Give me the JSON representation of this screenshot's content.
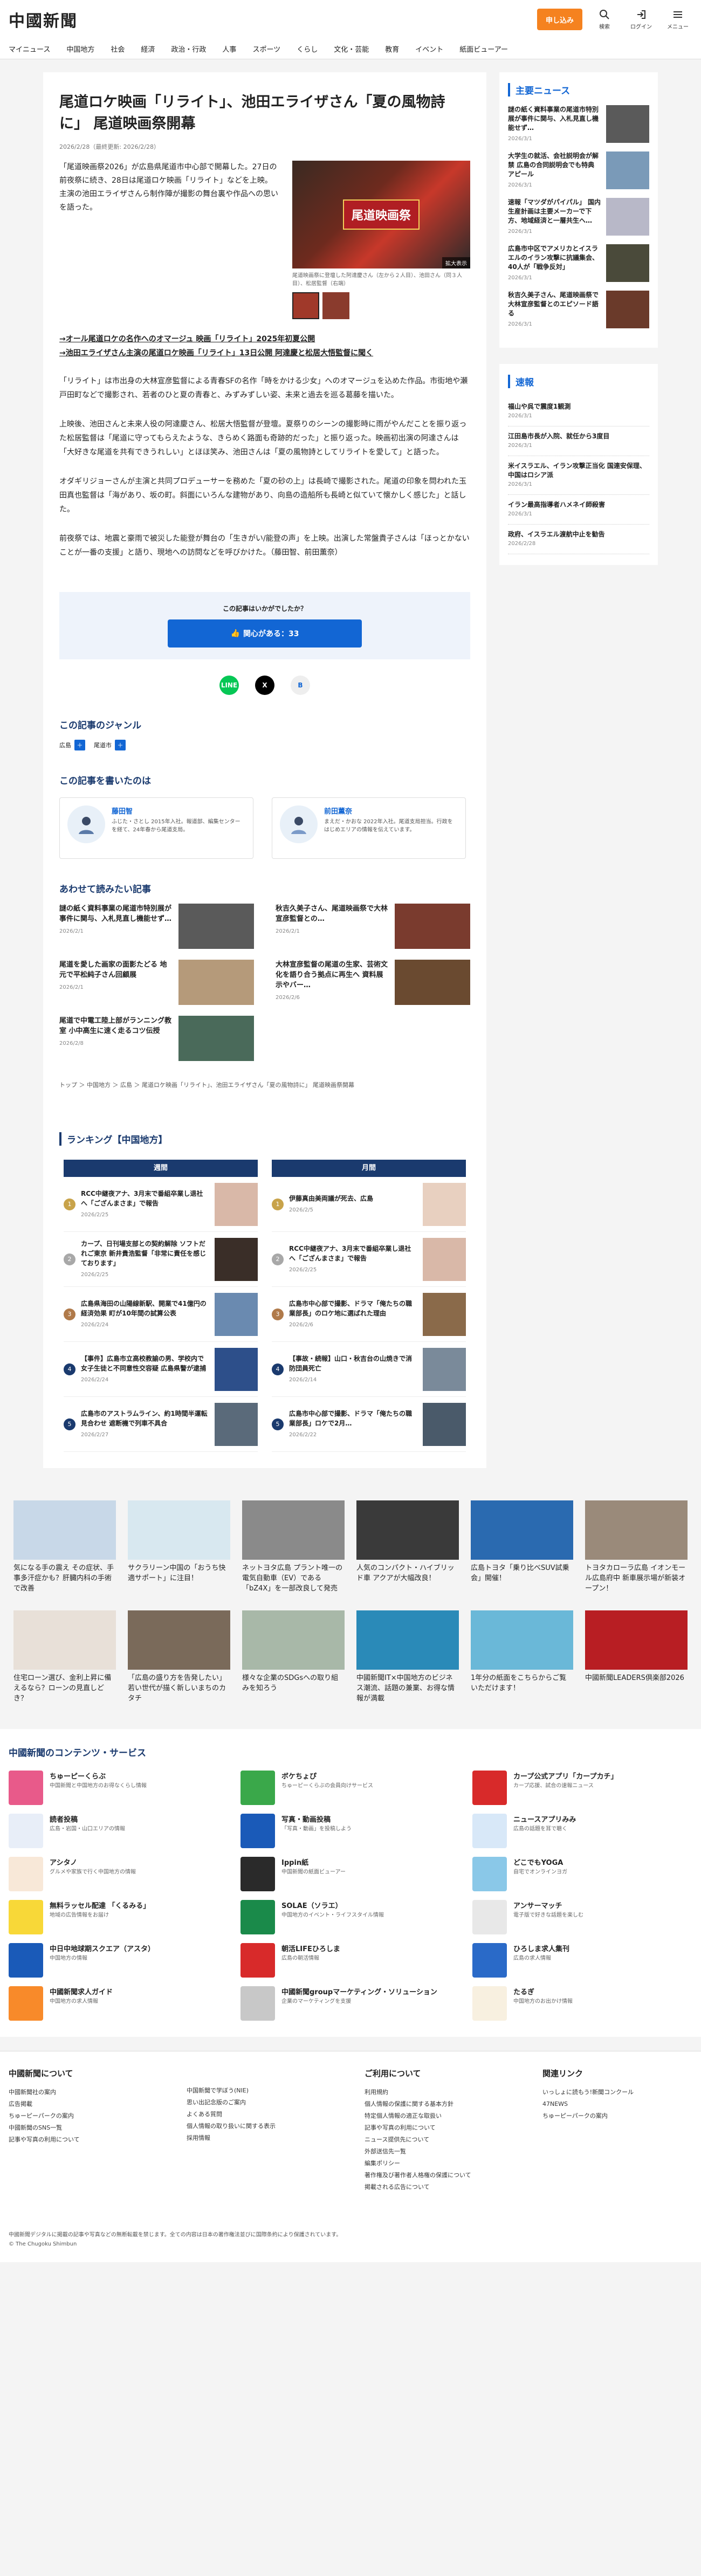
{
  "header": {
    "logo": "中國新聞",
    "subscribe": "申し込み",
    "search": "検索",
    "login": "ログイン",
    "menu": "メニュー"
  },
  "nav": [
    "マイニュース",
    "中国地方",
    "社会",
    "経済",
    "政治・行政",
    "人事",
    "スポーツ",
    "くらし",
    "文化・芸能",
    "教育",
    "イベント",
    "紙面ビューアー"
  ],
  "article": {
    "title": "尾道ロケ映画「リライト」、池田エライザさん「夏の風物詩に」 尾道映画祭開幕",
    "date": "2026/2/28（最終更新: 2026/2/28）",
    "lead": "「尾道映画祭2026」が広島県尾道市中心部で開幕した。27日の前夜祭に続き、28日は尾道ロケ映画「リライト」などを上映。主演の池田エライザさんら制作陣が撮影の舞台裏や作品への思いを語った。",
    "photo_sign": "尾道映画祭",
    "zoom": "拡大表示",
    "caption": "尾道映画祭に登壇した阿達慶さん（左から２人目）、池田さん（同３人目）、松居監督（右端）",
    "links": [
      "→オール尾道ロケの名作へのオマージュ 映画「リライト」2025年初夏公開",
      "→池田エライザさん主演の尾道ロケ映画「リライト」13日公開 阿達慶と松居大悟監督に聞く"
    ],
    "paragraphs": [
      "「リライト」は市出身の大林宣彦監督による青春SFの名作「時をかける少女」へのオマージュを込めた作品。市街地や瀬戸田町などで撮影され、若者のひと夏の青春と、みずみずしい姿、未来と過去を巡る葛藤を描いた。",
      "上映後、池田さんと未来人役の阿達慶さん、松居大悟監督が登壇。夏祭りのシーンの撮影時に雨がやんだことを振り返った松居監督は「尾道に守ってもらえたような、きらめく路面も奇跡的だった」と振り返った。映画初出演の阿達さんは「大好きな尾道を共有できうれしい」とほほ笑み、池田さんは「夏の風物詩としてリライトを愛して」と語った。",
      "オダギリジョーさんが主演と共同プロデューサーを務めた「夏の砂の上」は長崎で撮影された。尾道の印象を問われた玉田真也監督は「海があり、坂の町。斜面にいろんな建物があり、向島の造船所も長崎と似ていて懐かしく感じた」と話した。",
      "前夜祭では、地震と豪雨で被災した能登が舞台の「生きがい/能登の声」を上映。出演した常盤貴子さんは「ほっとかないことが一番の支援」と語り、現地への訪問などを呼びかけた。（藤田智、前田薫奈）"
    ],
    "feedback_q": "この記事はいかがでしたか？",
    "feedback_btn": "関心がある：33",
    "share": [
      "LINE",
      "X",
      "B"
    ]
  },
  "genre": {
    "title": "この記事のジャンル",
    "tags": [
      "広島",
      "尾道市"
    ]
  },
  "writers": {
    "title": "この記事を書いたのは",
    "items": [
      {
        "name": "藤田智",
        "desc": "ふじた・さとし 2015年入社。報道部、編集センターを経て、24年春から尾道支局。"
      },
      {
        "name": "前田薫奈",
        "desc": "まえだ・かおな 2022年入社。尾道支局担当。行政をはじめエリアの情報を伝えています。"
      }
    ]
  },
  "related": {
    "title": "あわせて読みたい記事",
    "items": [
      {
        "t": "謎の紙く資料事業の尾道市特別展が事件に関与、入札見直し機能せず…",
        "d": "2026/2/1"
      },
      {
        "t": "秋吉久美子さん、尾道映画祭で大林宣彦監督との…",
        "d": "2026/2/1"
      },
      {
        "t": "尾道を愛した画家の面影たどる 地元で平松純子さん回顧展",
        "d": "2026/2/1"
      },
      {
        "t": "大林宣彦監督の尾道の生家、芸術文化を語り合う拠点に再生へ 資料展示やバー…",
        "d": "2026/2/6"
      },
      {
        "t": "尾道で中電工陸上部がランニング教室 小中高生に速く走るコツ伝授",
        "d": "2026/2/8"
      }
    ]
  },
  "breadcrumb": "トップ ＞ 中国地方 ＞ 広島 ＞ 尾道ロケ映画「リライト」、池田エライザさん「夏の風物詩に」 尾道映画祭開幕",
  "ranking": {
    "title": "ランキング【中国地方】",
    "tabs": [
      "週間",
      "月間"
    ],
    "weekly": [
      {
        "t": "RCC中継夜アナ、3月末で番組卒業し退社へ「ござんまさま」で報告",
        "d": "2026/2/25"
      },
      {
        "t": "カープ、日刊場支部との契約解除 ソフトだれご東京 新井貴浩監督「非常に責任を感じております」",
        "d": "2026/2/25"
      },
      {
        "t": "広島県海田の山陽線新駅、開業で41億円の経済効果 町が10年間の試算公表",
        "d": "2026/2/24"
      },
      {
        "t": "【事件】広島市立高校教諭の男、学校内で女子生徒と不同意性交容疑 広島県警が逮捕",
        "d": "2026/2/24"
      },
      {
        "t": "広島市のアストラムライン、約1時間半運転見合わせ 遮断機で列車不具合",
        "d": "2026/2/27"
      }
    ],
    "monthly": [
      {
        "t": "伊藤真由美両議が死去、広島",
        "d": "2026/2/5"
      },
      {
        "t": "RCC中継夜アナ、3月末で番組卒業し退社へ「ござんまさま」で報告",
        "d": "2026/2/25"
      },
      {
        "t": "広島市中心部で撮影、ドラマ「俺たちの職業部長」のロケ地に選ばれた理由",
        "d": "2026/2/6"
      },
      {
        "t": "【事故・続報】山口・秋吉台の山焼きで消防団員死亡",
        "d": "2026/2/14"
      },
      {
        "t": "広島市中心部で撮影、ドラマ「俺たちの職業部長」ロケで2月…",
        "d": "2026/2/22"
      }
    ]
  },
  "sidebar": {
    "main_title": "主要ニュース",
    "main": [
      {
        "t": "謎の紙く資料事業の尾道市特別展が事件に関与、入札見直し機能せず…",
        "d": "2026/3/1"
      },
      {
        "t": "大学生の就活、会社説明会が解禁 広島の合同説明会でも特典アピール",
        "d": "2026/3/1"
      },
      {
        "t": "速報「マツダがパイパル」 国内生産計画は主要メーカーで下方、地域経済と一層共生へ…",
        "d": "2026/3/1"
      },
      {
        "t": "広島市中区でアメリカとイスラエルのイラン攻撃に抗議集会、40人が「戦争反対」",
        "d": "2026/3/1"
      },
      {
        "t": "秋吉久美子さん、尾道映画祭で大林宣彦監督とのエピソード語る",
        "d": "2026/3/1"
      }
    ],
    "speed_title": "速報",
    "speed": [
      {
        "t": "福山や呉で震度1観測",
        "d": "2026/3/1"
      },
      {
        "t": "江田島市長が入院、就任から3度目",
        "d": "2026/3/1"
      },
      {
        "t": "米イスラエル、イラン攻撃正当化 国連安保理、中国はロシア派",
        "d": "2026/3/1"
      },
      {
        "t": "イラン最高指導者ハメネイ師殺害",
        "d": "2026/3/1"
      },
      {
        "t": "政府、イスラエル渡航中止を勧告",
        "d": "2026/2/28"
      }
    ]
  },
  "promos": [
    "気になる手の震え その症状、手事多汗症かも？肝臓内科の手術で改善",
    "サクラリーン中国の「おうち快適サポート」に注目！",
    "ネットヨタ広島 プラント唯一の電気自動車（EV）である「bZ4X」を一部改良して発売",
    "人気のコンパクト・ハイブリッド車 アクアが大幅改良！",
    "広島トヨタ「乗り比べSUV試乗会」開催！",
    "トヨタカローラ広島 イオンモール広島府中 新車展示場が新装オープン！",
    "住宅ローン選び、金利上昇に備えるなら？ローンの見直しどき？",
    "「広島の盛り方を告発したい」若い世代が描く新しいまちのカタチ",
    "様々な企業のSDGsへの取り組みを知ろう",
    "中國新聞IT×中国地方のビジネス潮流、話題の兼業、お得な情報が満載",
    "1年分の紙面をこちらからご覧いただけます！",
    "中國新聞LEADERS倶楽部2026"
  ],
  "services": {
    "title": "中國新聞のコンテンツ・サービス",
    "items": [
      {
        "n": "ちゅーピーくらぶ",
        "d": "中国新聞と中国地方のお得なくらし情報"
      },
      {
        "n": "ボケちょぴ",
        "d": "ちゅーピーくらぶの会員向けサービス"
      },
      {
        "n": "カープ公式アプリ「カープカチ」",
        "d": "カープ応援、試合の速報ニュース"
      },
      {
        "n": "読者投稿",
        "d": "広島・岩国・山口エリアの情報"
      },
      {
        "n": "写真・動画投稿",
        "d": "「写真・動画」を投稿しよう"
      },
      {
        "n": "ニュースアプリみみ",
        "d": "広島の話題を耳で聴く"
      },
      {
        "n": "アシタノ",
        "d": "グルメや家族で行く中国地方の情報"
      },
      {
        "n": "Ippin紙",
        "d": "中国新聞の紙面ビューアー"
      },
      {
        "n": "どこでもYOGA",
        "d": "自宅でオンラインヨガ"
      },
      {
        "n": "無料ラッセル配達 「くるみる」",
        "d": "地域の広告情報をお届け"
      },
      {
        "n": "SOLAE（ソラエ）",
        "d": "中国地方のイベント・ライフスタイル情報"
      },
      {
        "n": "アンサーマッチ",
        "d": "電子版で好きな話題を楽しむ"
      },
      {
        "n": "中日中地球期スクエア（アスタ）",
        "d": "中国地方の情報"
      },
      {
        "n": "朝活LIFEひろしま",
        "d": "広島の朝活情報"
      },
      {
        "n": "ひろしま求人集刊",
        "d": "広島の求人情報"
      },
      {
        "n": "中國新聞求人ガイド",
        "d": "中国地方の求人情報"
      },
      {
        "n": "中國新聞groupマーケティング・ソリューション",
        "d": "企業のマーケティングを支援"
      },
      {
        "n": "たるぎ",
        "d": "中国地方のお出かけ情報"
      }
    ]
  },
  "footer": {
    "cols": [
      {
        "h": "中國新聞について",
        "l": [
          "中國新聞社の案内",
          "広告掲載",
          "ちゅーピーパークの案内",
          "中國新聞のSNS一覧",
          "記事や写真の利用について"
        ]
      },
      {
        "h": "",
        "l": [
          "中国新聞で学ぼう(NIE)",
          "思い出記念版のご案内",
          "よくある質問",
          "個人情報の取り扱いに関する表示",
          "採用情報"
        ]
      },
      {
        "h": "ご利用について",
        "l": [
          "利用規約",
          "個人情報の保護に関する基本方針",
          "特定個人情報の適正な取扱い",
          "記事や写真の利用について",
          "ニュース提供先について",
          "外部送信先一覧",
          "編集ポリシー",
          "著作権及び著作者人格権の保護について",
          "掲載される広告について"
        ]
      },
      {
        "h": "関連リンク",
        "l": [
          "いっしょに読もう!新聞コンクール",
          "47NEWS",
          "ちゅーピーパークの案内"
        ]
      }
    ],
    "notice": "中國新聞デジタルに掲載の記事や写真などの無断転載を禁じます。全ての内容は日本の著作権法並びに国際条約により保護されています。",
    "copyright": "© The Chugoku Shimbun"
  },
  "colors": {
    "accent": "#f5821f",
    "navy": "#1a3a6e",
    "blue": "#1266d4"
  }
}
